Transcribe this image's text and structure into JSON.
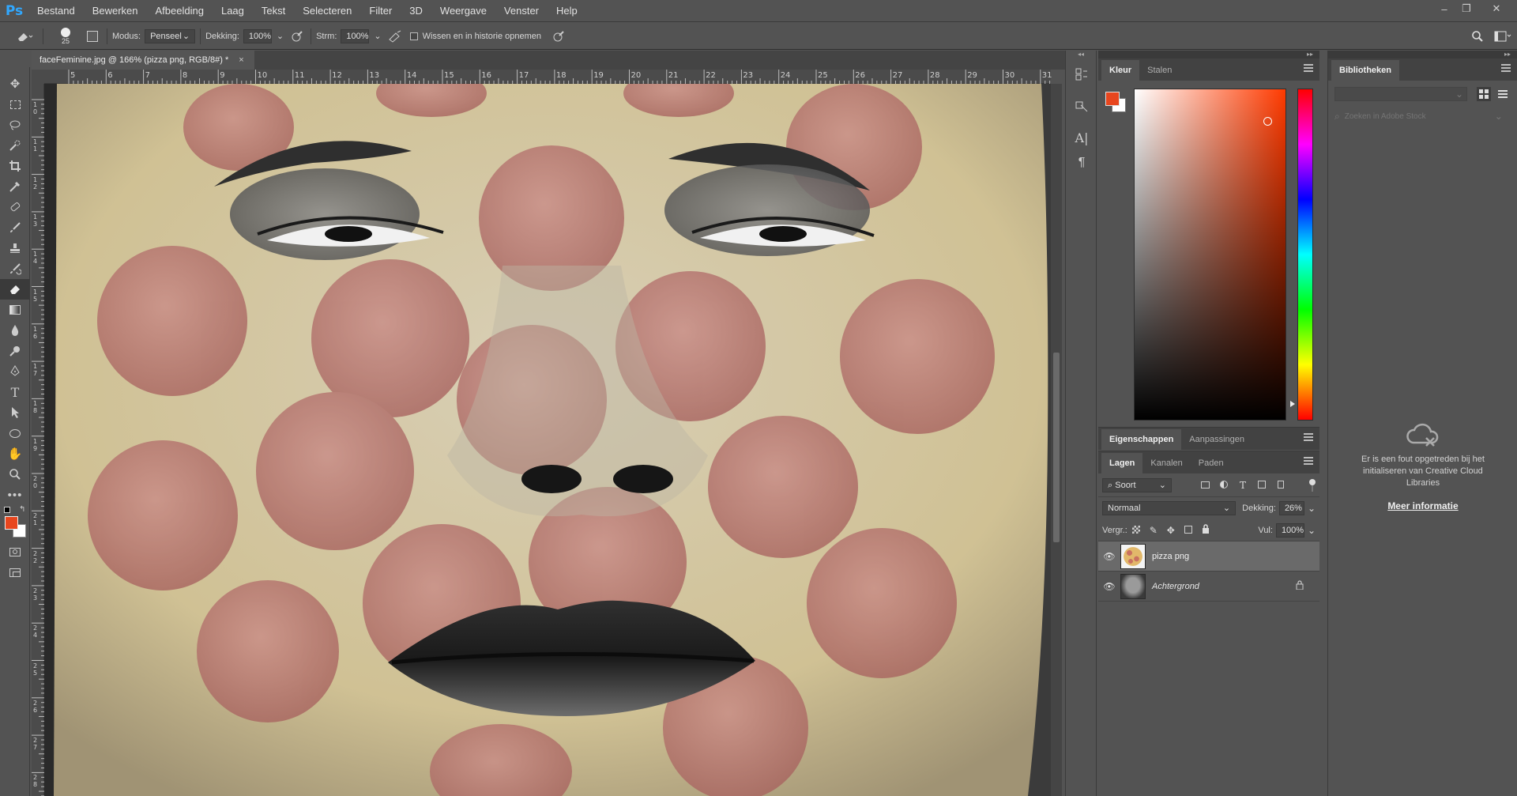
{
  "app": {
    "logo": "Ps"
  },
  "menu": [
    "Bestand",
    "Bewerken",
    "Afbeelding",
    "Laag",
    "Tekst",
    "Selecteren",
    "Filter",
    "3D",
    "Weergave",
    "Venster",
    "Help"
  ],
  "window_controls": {
    "minimize": "–",
    "restore": "❐",
    "close": "✕"
  },
  "options_bar": {
    "brush_size": "25",
    "mode_label": "Modus:",
    "mode_value": "Penseel",
    "opacity_label": "Dekking:",
    "opacity_value": "100%",
    "flow_label": "Strm:",
    "flow_value": "100%",
    "erase_history_label": "Wissen en in historie opnemen"
  },
  "document": {
    "tab_title": "faceFeminine.jpg @ 166% (pizza png, RGB/8#) *",
    "close_glyph": "×"
  },
  "ruler_top": [
    "5",
    "6",
    "7",
    "8",
    "9",
    "10",
    "11",
    "12",
    "13",
    "14",
    "15",
    "16",
    "17",
    "18",
    "19",
    "20",
    "21",
    "22",
    "23",
    "24",
    "25",
    "26",
    "27",
    "28",
    "29",
    "30",
    "31"
  ],
  "ruler_left": [
    "1\n0",
    "1\n1",
    "1\n2",
    "1\n3",
    "1\n4",
    "1\n5",
    "1\n6",
    "1\n7",
    "1\n8",
    "1\n9",
    "2\n0",
    "2\n1",
    "2\n2",
    "2\n3",
    "2\n4",
    "2\n5",
    "2\n6",
    "2\n7",
    "2\n8"
  ],
  "color_panel": {
    "tabs": [
      "Kleur",
      "Stalen"
    ],
    "foreground": "#e8461e",
    "background": "#ffffff",
    "hue_color": "#ff3a00"
  },
  "properties_panel": {
    "tabs": [
      "Eigenschappen",
      "Aanpassingen"
    ]
  },
  "layers_panel": {
    "tabs": [
      "Lagen",
      "Kanalen",
      "Paden"
    ],
    "filter_label": "Soort",
    "blend_mode": "Normaal",
    "opacity_label": "Dekking:",
    "opacity_value": "26%",
    "lock_label": "Vergr.:",
    "fill_label": "Vul:",
    "fill_value": "100%",
    "layers": [
      {
        "name": "pizza png",
        "selected": true,
        "locked": false
      },
      {
        "name": "Achtergrond",
        "selected": false,
        "locked": true
      }
    ]
  },
  "libraries_panel": {
    "tab": "Bibliotheken",
    "search_placeholder": "Zoeken in Adobe Stock",
    "error_message": "Er is een fout opgetreden bij het initialiseren van Creative Cloud Libraries",
    "more_info_link": "Meer informatie"
  },
  "colors": {
    "accent": "#31a8ff",
    "chrome": "#535353",
    "dark_chrome": "#424242"
  }
}
